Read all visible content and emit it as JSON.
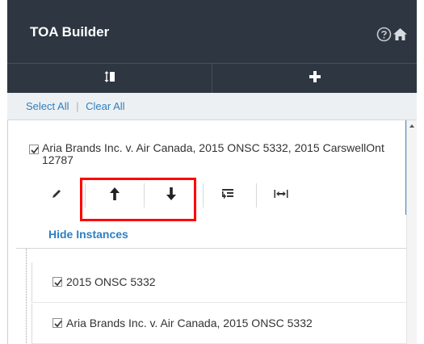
{
  "header": {
    "title": "TOA Builder",
    "help_icon": "help-circle-icon",
    "home_icon": "home-icon",
    "background": "#2d3641"
  },
  "toolbar": {
    "tools": [
      {
        "name": "reorder-list-icon"
      },
      {
        "name": "add-icon"
      }
    ]
  },
  "selection": {
    "select_all": "Select All",
    "separator": "|",
    "clear_all": "Clear All"
  },
  "citation": {
    "checked": true,
    "text": "Aria Brands Inc. v. Air Canada, 2015 ONSC 5332, 2015 CarswellOnt 12787",
    "actions": [
      {
        "name": "edit-pencil-icon"
      },
      {
        "name": "move-up-arrow-icon"
      },
      {
        "name": "move-down-arrow-icon"
      },
      {
        "name": "insert-text-icon"
      },
      {
        "name": "expand-width-icon"
      }
    ],
    "hide_instances": "Hide Instances"
  },
  "instances": [
    {
      "checked": true,
      "text": "2015 ONSC 5332"
    },
    {
      "checked": true,
      "text": "Aria Brands Inc. v. Air Canada, 2015 ONSC 5332"
    }
  ],
  "colors": {
    "accent": "#2e7fc1",
    "highlight": "#ff0000",
    "selected_border": "#3a8ad0"
  }
}
